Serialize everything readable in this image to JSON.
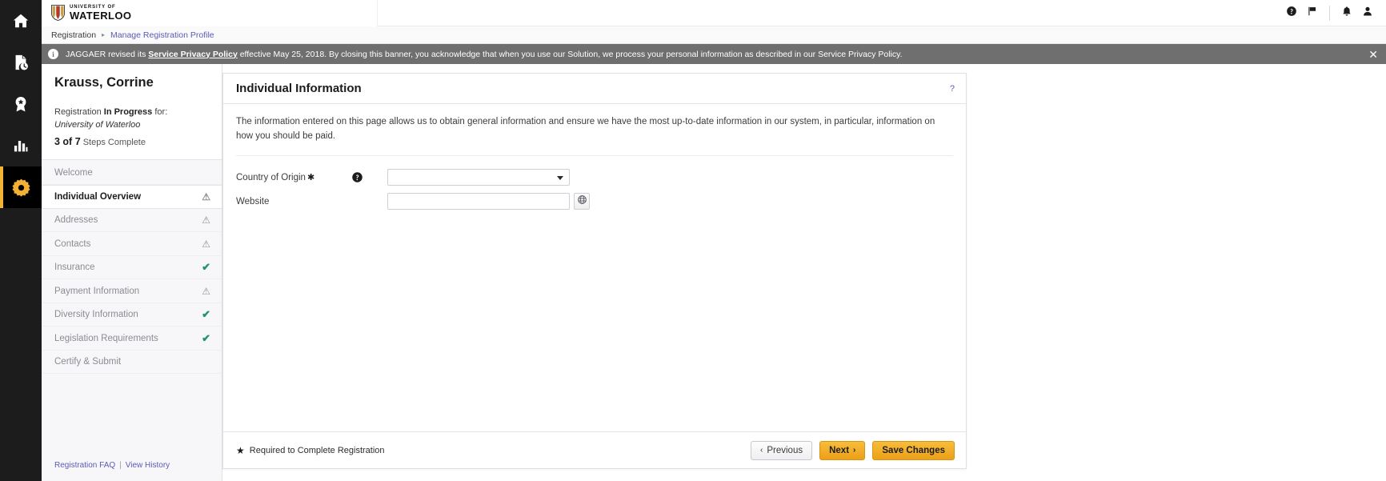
{
  "rail": {
    "items": [
      {
        "name": "home-icon",
        "label": "Home"
      },
      {
        "name": "orders-icon",
        "label": "Orders"
      },
      {
        "name": "supplier-icon",
        "label": "Supplier Management"
      },
      {
        "name": "reporting-icon",
        "label": "Reporting"
      },
      {
        "name": "settings-icon",
        "label": "Administer"
      }
    ],
    "active_index": 4
  },
  "topbar": {
    "logo_small": "UNIVERSITY OF",
    "logo_big": "WATERLOO",
    "icons": [
      {
        "name": "help-icon",
        "label": "Help"
      },
      {
        "name": "flag-icon",
        "label": "Bookmarks"
      },
      {
        "name": "bell-icon",
        "label": "Notifications"
      },
      {
        "name": "user-icon",
        "label": "Profile"
      }
    ]
  },
  "breadcrumb": {
    "root": "Registration",
    "separator": "▸",
    "current": "Manage Registration Profile"
  },
  "banner": {
    "info_glyph": "i",
    "text_before": "JAGGAER revised its ",
    "link_text": "Service Privacy Policy",
    "text_after": " effective May 25, 2018. By closing this banner, you acknowledge that when you use our Solution, we process your personal information as described in our Service Privacy Policy.",
    "close_glyph": "✕",
    "background": "#6f6f6f"
  },
  "panel": {
    "name": "Krauss, Corrine",
    "status_prefix": "Registration ",
    "status_strong": "In Progress",
    "status_suffix": " for:",
    "organization": "University of Waterloo",
    "steps_done": "3 of 7",
    "steps_label": "Steps Complete",
    "steps": [
      {
        "label": "Welcome",
        "mark": "",
        "state": "none",
        "current": false
      },
      {
        "label": "Individual Overview",
        "mark": "⚠",
        "state": "warn",
        "current": true
      },
      {
        "label": "Addresses",
        "mark": "⚠",
        "state": "warn",
        "current": false
      },
      {
        "label": "Contacts",
        "mark": "⚠",
        "state": "warn",
        "current": false
      },
      {
        "label": "Insurance",
        "mark": "✔",
        "state": "ok",
        "current": false
      },
      {
        "label": "Payment Information",
        "mark": "⚠",
        "state": "warn",
        "current": false
      },
      {
        "label": "Diversity Information",
        "mark": "✔",
        "state": "ok",
        "current": false
      },
      {
        "label": "Legislation Requirements",
        "mark": "✔",
        "state": "ok",
        "current": false
      },
      {
        "label": "Certify & Submit",
        "mark": "",
        "state": "none",
        "current": false
      }
    ],
    "link_faq": "Registration FAQ",
    "link_sep": "|",
    "link_history": "View History"
  },
  "card": {
    "title": "Individual Information",
    "help_glyph": "?",
    "description": "The information entered on this page allows us to obtain general information and ensure we have the most up-to-date information in our system, in particular, information on how you should be paid.",
    "fields": [
      {
        "label": "Country of Origin",
        "required": true,
        "star": "✱",
        "has_help": true,
        "control": "select",
        "value": "",
        "placeholder": ""
      },
      {
        "label": "Website",
        "required": false,
        "star": "",
        "has_help": false,
        "control": "text",
        "value": "",
        "placeholder": "",
        "addon": "globe-icon"
      }
    ],
    "footer": {
      "required_star": "★",
      "required_note": "Required to Complete Registration",
      "previous_arrow": "‹",
      "previous_label": "Previous",
      "next_label": "Next",
      "next_arrow": "›",
      "save_label": "Save Changes"
    }
  },
  "colors": {
    "accent": "#f2b134",
    "rail_bg": "#1c1c1c",
    "banner_bg": "#6f6f6f",
    "link": "#5a5ab8",
    "ok_green": "#1f9464",
    "warn_grey": "#8f8f96"
  }
}
